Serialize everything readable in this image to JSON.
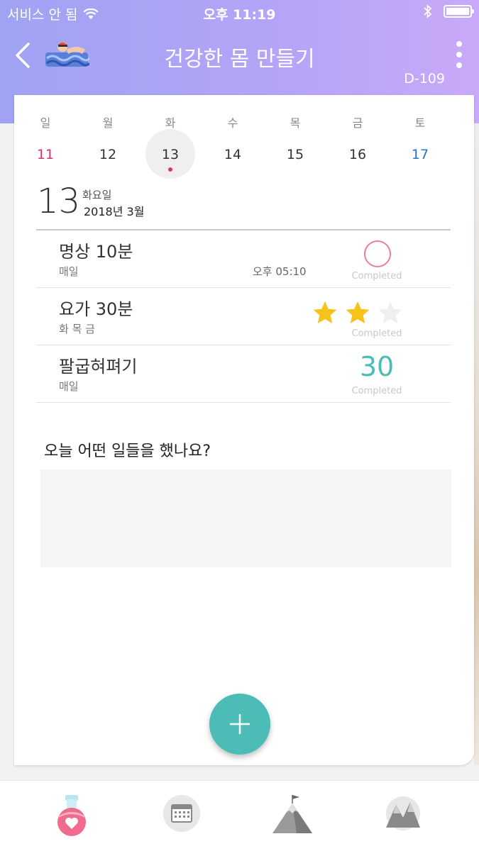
{
  "status_bar": {
    "carrier": "서비스 안 됨",
    "time": "오후 11:19"
  },
  "header": {
    "title": "건강한 몸 만들기",
    "dday": "D-109",
    "goal_icon": "swimmer-icon"
  },
  "calendar": {
    "weekdays": [
      "일",
      "월",
      "화",
      "수",
      "목",
      "금",
      "토"
    ],
    "dates": [
      "11",
      "12",
      "13",
      "14",
      "15",
      "16",
      "17"
    ],
    "selected_index": 2
  },
  "selected_day": {
    "day": "13",
    "weekday": "화요일",
    "year_month": "2018년 3월"
  },
  "habits": [
    {
      "name": "명상 10분",
      "frequency": "매일",
      "alarm": "오후 05:10",
      "status_label": "Completed",
      "status_type": "ring"
    },
    {
      "name": "요가 30분",
      "frequency": "화 목 금",
      "alarm": "",
      "status_label": "Completed",
      "status_type": "stars",
      "stars_filled": 2,
      "stars_total": 3
    },
    {
      "name": "팔굽혀펴기",
      "frequency": "매일",
      "alarm": "",
      "status_label": "Completed",
      "status_type": "count",
      "count": "30"
    }
  ],
  "journal": {
    "question": "오늘 어떤 일들을 했나요?",
    "placeholder": ""
  },
  "colors": {
    "accent": "#4bbdb6",
    "sunday": "#e0326a",
    "saturday": "#2a6fd8",
    "ring": "#ea7f9a",
    "star": "#f7c21b"
  },
  "tabbar": {
    "items": [
      {
        "icon": "potion-heart-icon"
      },
      {
        "icon": "calendar-icon"
      },
      {
        "icon": "mountain-flag-icon"
      },
      {
        "icon": "mountains-icon"
      }
    ]
  }
}
